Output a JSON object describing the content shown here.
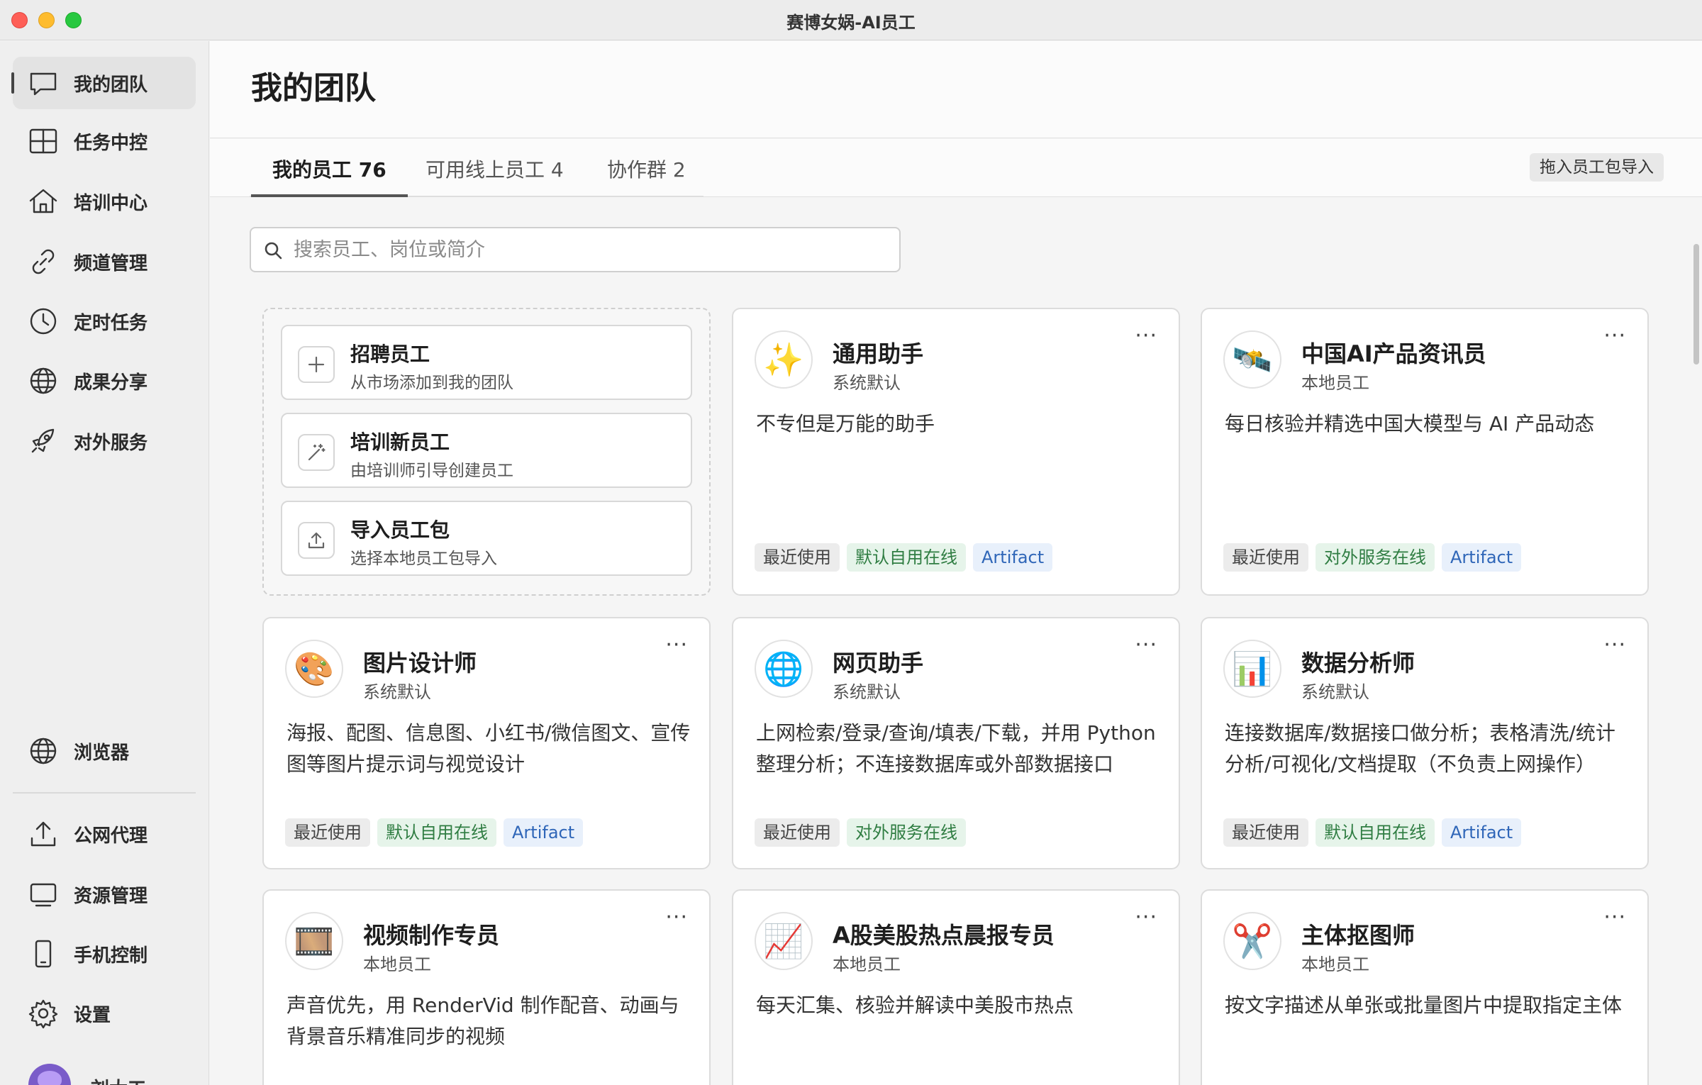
{
  "window": {
    "title": "赛博女娲-AI员工"
  },
  "sidebar": {
    "items": [
      {
        "label": "我的团队",
        "icon": "chat-icon"
      },
      {
        "label": "任务中控",
        "icon": "grid-icon"
      },
      {
        "label": "培训中心",
        "icon": "home-icon"
      },
      {
        "label": "频道管理",
        "icon": "link-icon"
      },
      {
        "label": "定时任务",
        "icon": "clock-icon"
      },
      {
        "label": "成果分享",
        "icon": "globe-icon"
      },
      {
        "label": "对外服务",
        "icon": "rocket-icon"
      }
    ],
    "bottom_items": [
      {
        "label": "浏览器",
        "icon": "globe-icon"
      },
      {
        "label": "公网代理",
        "icon": "upload-icon"
      },
      {
        "label": "资源管理",
        "icon": "monitor-icon"
      },
      {
        "label": "手机控制",
        "icon": "phone-icon"
      },
      {
        "label": "设置",
        "icon": "gear-icon"
      }
    ],
    "user_name": "刘大工"
  },
  "page": {
    "title": "我的团队"
  },
  "tabs": [
    {
      "label": "我的员工 76"
    },
    {
      "label": "可用线上员工 4"
    },
    {
      "label": "协作群 2"
    }
  ],
  "import_drop_label": "拖入员工包导入",
  "search": {
    "placeholder": "搜索员工、岗位或简介"
  },
  "actions": [
    {
      "title": "招聘员工",
      "sub": "从市场添加到我的团队",
      "icon": "plus-icon"
    },
    {
      "title": "培训新员工",
      "sub": "由培训师引导创建员工",
      "icon": "wand-icon"
    },
    {
      "title": "导入员工包",
      "sub": "选择本地员工包导入",
      "icon": "upload-icon"
    }
  ],
  "employees": [
    {
      "name": "通用助手",
      "type": "系统默认",
      "desc": "不专但是万能的助手",
      "emoji": "✨",
      "tags": [
        "最近使用",
        "默认自用在线",
        "Artifact"
      ]
    },
    {
      "name": "中国AI产品资讯员",
      "type": "本地员工",
      "desc": "每日核验并精选中国大模型与 AI 产品动态",
      "emoji": "🛰️",
      "tags": [
        "最近使用",
        "对外服务在线",
        "Artifact"
      ]
    },
    {
      "name": "图片设计师",
      "type": "系统默认",
      "desc": "海报、配图、信息图、小红书/微信图文、宣传图等图片提示词与视觉设计",
      "emoji": "🎨",
      "tags": [
        "最近使用",
        "默认自用在线",
        "Artifact"
      ]
    },
    {
      "name": "网页助手",
      "type": "系统默认",
      "desc": "上网检索/登录/查询/填表/下载，并用 Python 整理分析；不连接数据库或外部数据接口",
      "emoji": "🌐",
      "tags": [
        "最近使用",
        "对外服务在线"
      ]
    },
    {
      "name": "数据分析师",
      "type": "系统默认",
      "desc": "连接数据库/数据接口做分析；表格清洗/统计分析/可视化/文档提取（不负责上网操作）",
      "emoji": "📊",
      "tags": [
        "最近使用",
        "默认自用在线",
        "Artifact"
      ]
    },
    {
      "name": "视频制作专员",
      "type": "本地员工",
      "desc": "声音优先，用 RenderVid 制作配音、动画与背景音乐精准同步的视频",
      "emoji": "🎞️",
      "tags": []
    },
    {
      "name": "A股美股热点晨报专员",
      "type": "本地员工",
      "desc": "每天汇集、核验并解读中美股市热点",
      "emoji": "📈",
      "tags": []
    },
    {
      "name": "主体抠图师",
      "type": "本地员工",
      "desc": "按文字描述从单张或批量图片中提取指定主体",
      "emoji": "✂️",
      "tags": []
    }
  ],
  "more_label": "···"
}
